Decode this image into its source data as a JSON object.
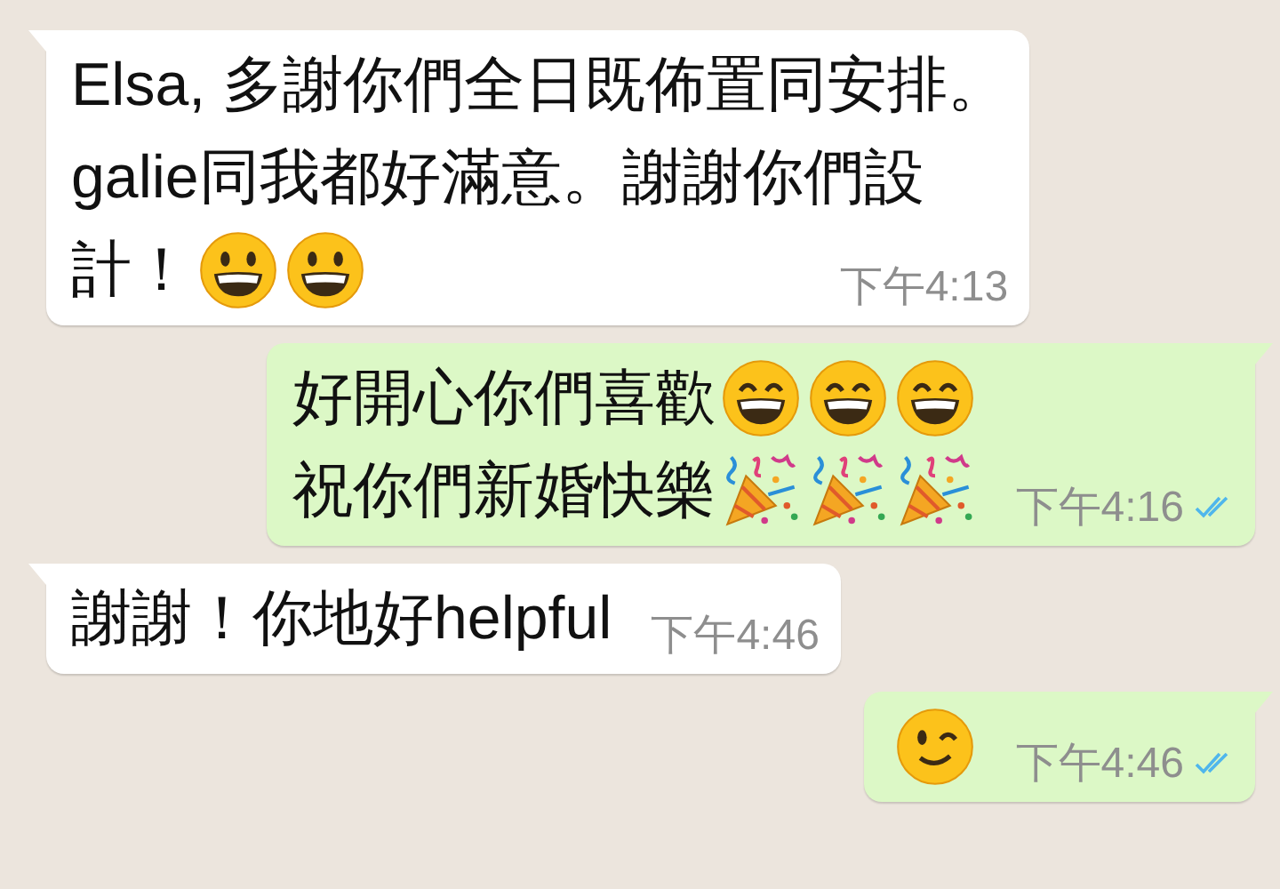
{
  "messages": [
    {
      "kind": "received",
      "lines": [
        {
          "text": "Elsa, 多謝你們全日既佈置同安排。"
        },
        {
          "text": "galie同我都好滿意。謝謝你們設"
        },
        {
          "text": "計！",
          "emoji": [
            {
              "kind": "grin"
            },
            {
              "kind": "grin"
            }
          ]
        }
      ],
      "time": "下午4:13"
    },
    {
      "kind": "sent",
      "lines": [
        {
          "text": "好開心你們喜歡",
          "emoji": [
            {
              "kind": "smile"
            },
            {
              "kind": "smile"
            },
            {
              "kind": "smile"
            }
          ]
        },
        {
          "text": "祝你們新婚快樂",
          "emoji": [
            {
              "kind": "party"
            },
            {
              "kind": "party"
            },
            {
              "kind": "party"
            }
          ]
        }
      ],
      "time": "下午4:16",
      "read": true
    },
    {
      "kind": "received",
      "lines": [
        {
          "text": "謝謝！你地好helpful"
        }
      ],
      "time": "下午4:46"
    },
    {
      "kind": "sent",
      "lines": [
        {
          "emoji": [
            {
              "kind": "wink"
            }
          ]
        }
      ],
      "time": "下午4:46",
      "read": true
    }
  ]
}
